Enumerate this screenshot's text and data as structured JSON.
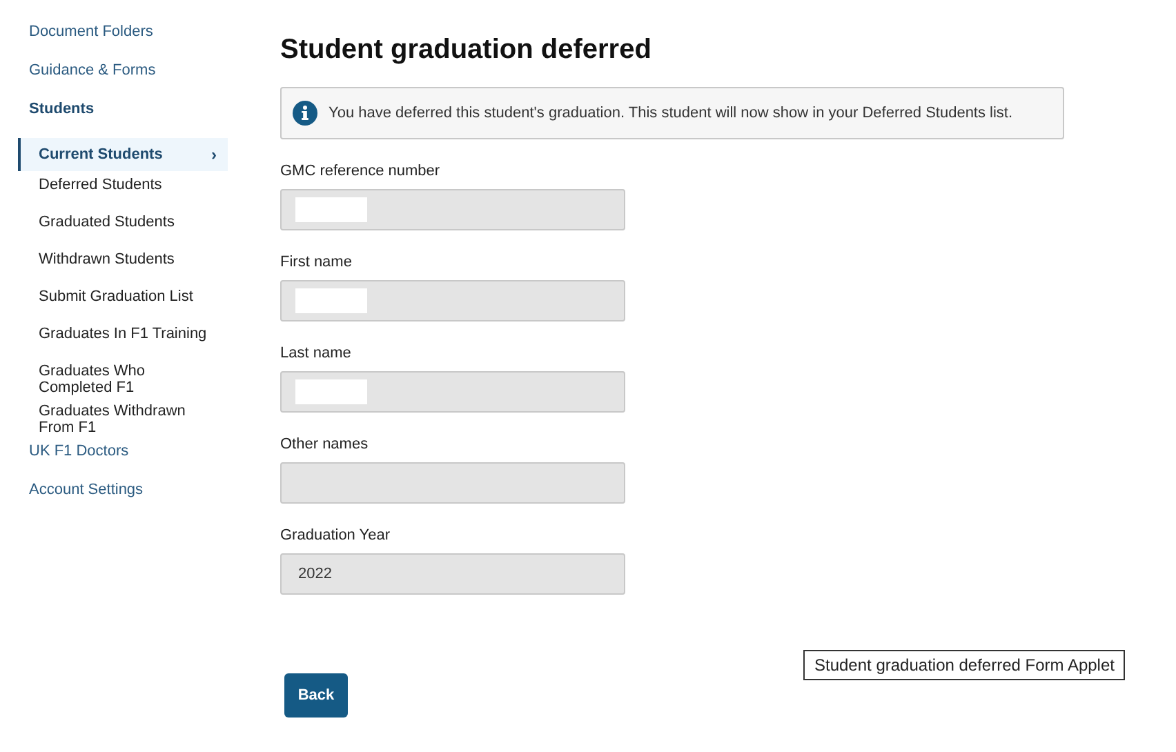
{
  "sidebar": {
    "items": [
      {
        "label": "Document Folders",
        "selected": false
      },
      {
        "label": "Guidance & Forms",
        "selected": false
      },
      {
        "label": "Students",
        "selected": false,
        "expanded": true,
        "children": [
          {
            "label": "Current Students",
            "selected": true,
            "chevron": "›"
          },
          {
            "label": "Deferred Students",
            "selected": false
          },
          {
            "label": "Graduated Students",
            "selected": false
          },
          {
            "label": "Withdrawn Students",
            "selected": false
          },
          {
            "label": "Submit Graduation List",
            "selected": false
          },
          {
            "label": "Graduates In F1 Training",
            "selected": false
          },
          {
            "label": "Graduates Who Completed F1",
            "selected": false
          },
          {
            "label": "Graduates Withdrawn From F1",
            "selected": false
          }
        ]
      },
      {
        "label": "UK F1 Doctors",
        "selected": false
      },
      {
        "label": "Account Settings",
        "selected": false
      }
    ]
  },
  "page": {
    "title": "Student graduation deferred",
    "notice": "You have deferred this student's graduation. This student will now show in your Deferred Students list.",
    "fields": [
      {
        "label": "GMC reference number",
        "redacted": true
      },
      {
        "label": "First name",
        "redacted": true
      },
      {
        "label": "Last name",
        "redacted": true
      },
      {
        "label": "Other names",
        "redacted": false
      },
      {
        "label": "Graduation Year",
        "value": "2022",
        "redacted": false
      }
    ],
    "tooltip": "Student graduation deferred Form Applet",
    "buttons": [
      "Back"
    ]
  }
}
